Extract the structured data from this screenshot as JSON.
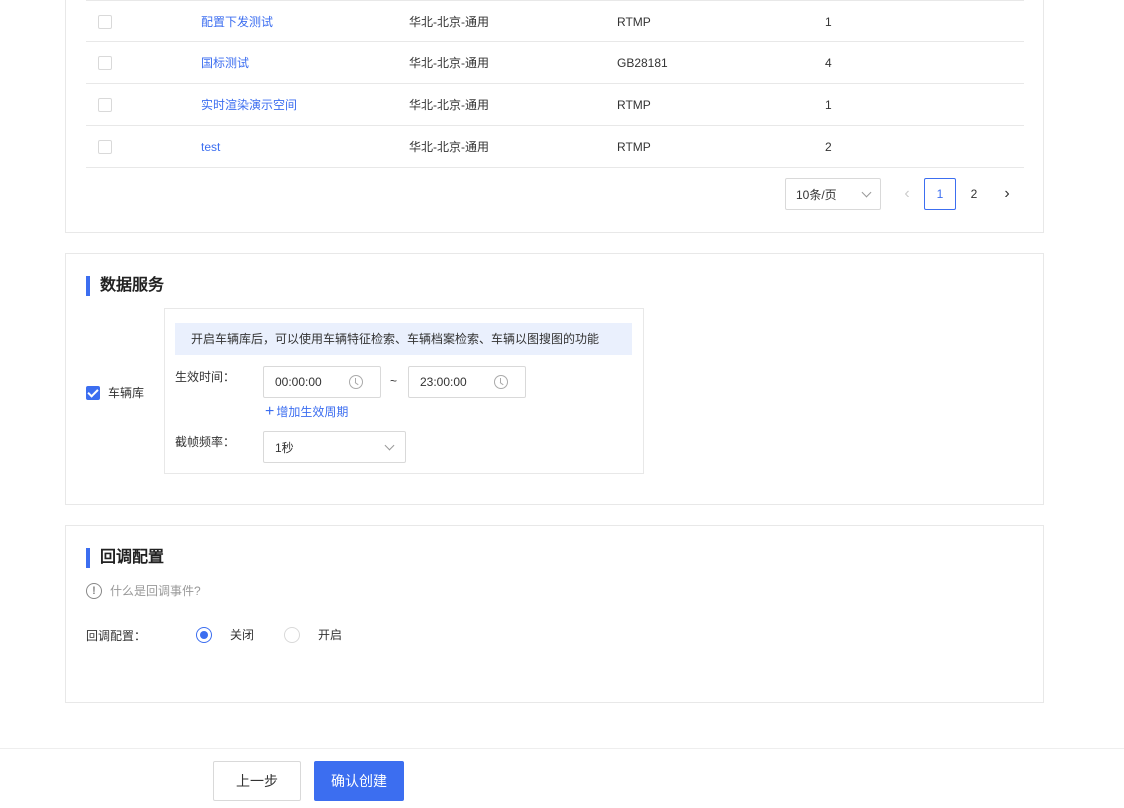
{
  "table": {
    "rows": [
      {
        "name": "配置下发测试",
        "region": "华北-北京-通用",
        "protocol": "RTMP",
        "count": "1"
      },
      {
        "name": "国标测试",
        "region": "华北-北京-通用",
        "protocol": "GB28181",
        "count": "4"
      },
      {
        "name": "实时渲染演示空间",
        "region": "华北-北京-通用",
        "protocol": "RTMP",
        "count": "1"
      },
      {
        "name": "test",
        "region": "华北-北京-通用",
        "protocol": "RTMP",
        "count": "2"
      }
    ]
  },
  "pagination": {
    "page_size": "10条/页",
    "pages": [
      "1",
      "2"
    ],
    "current": "1"
  },
  "data_service": {
    "title": "数据服务",
    "vehicle_lib_label": "车辆库",
    "vehicle_lib_checked": true,
    "tip": "开启车辆库后，可以使用车辆特征检索、车辆档案检索、车辆以图搜图的功能",
    "effective_time_label": "生效时间：",
    "start_time": "00:00:00",
    "separator": "~",
    "end_time": "23:00:00",
    "add_period": "增加生效周期",
    "frame_rate_label": "截帧频率：",
    "frame_rate": "1秒"
  },
  "callback": {
    "title": "回调配置",
    "help": "什么是回调事件?",
    "label": "回调配置：",
    "options": [
      "关闭",
      "开启"
    ],
    "selected": "关闭"
  },
  "footer": {
    "prev": "上一步",
    "confirm": "确认创建"
  },
  "colors": {
    "primary": "#3c6ef0",
    "tip_bg": "#eaf0fd"
  }
}
